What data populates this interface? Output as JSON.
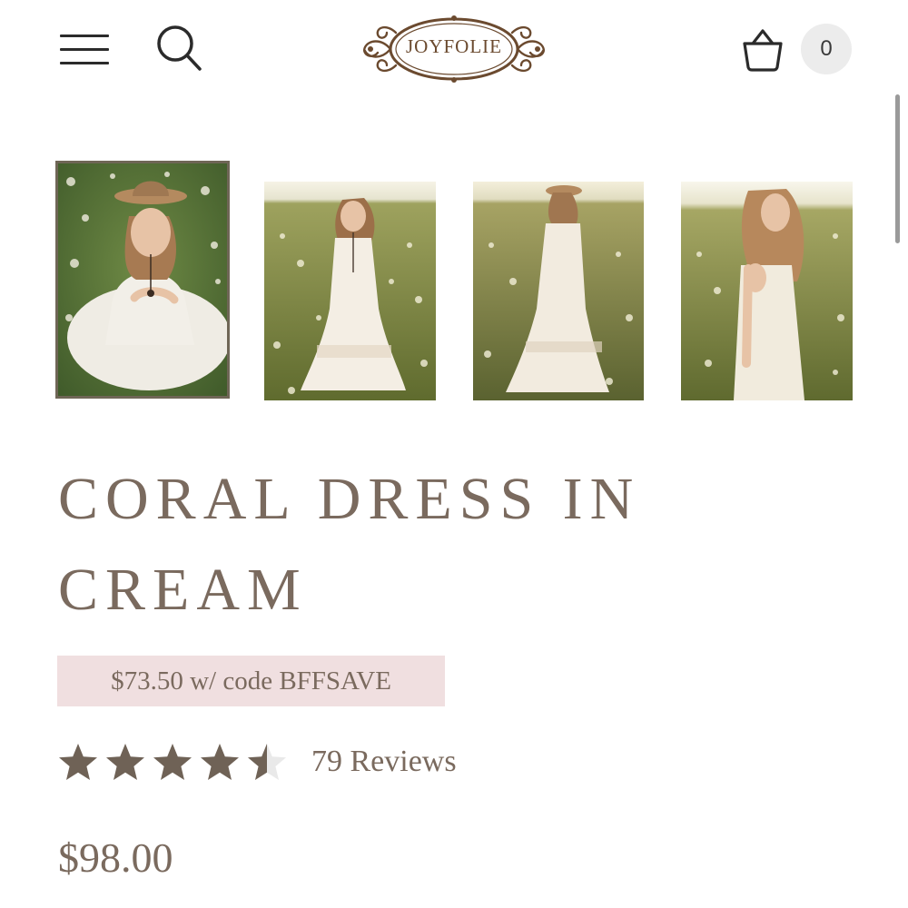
{
  "header": {
    "menu_icon": "hamburger-menu-icon",
    "search_icon": "search-icon",
    "logo_text": "JOYFOLIE",
    "cart_icon": "basket-icon",
    "cart_count": "0"
  },
  "gallery": {
    "thumbnails": [
      {
        "description_icon": "model-sitting-with-hat-photo",
        "selected": true
      },
      {
        "description_icon": "model-standing-front-photo",
        "selected": false
      },
      {
        "description_icon": "model-standing-back-with-hat-photo",
        "selected": false
      },
      {
        "description_icon": "model-side-profile-photo",
        "selected": false
      }
    ]
  },
  "product": {
    "title": "CORAL DRESS IN CREAM",
    "promo_text": "$73.50 w/ code BFFSAVE",
    "rating": 4.5,
    "rating_max": 5,
    "reviews_label": "79 Reviews",
    "price": "$98.00"
  },
  "colors": {
    "text": "#7a6a5e",
    "promo_bg": "#f0dfe0",
    "star": "#6f6256",
    "logo": "#6b4a2f"
  }
}
